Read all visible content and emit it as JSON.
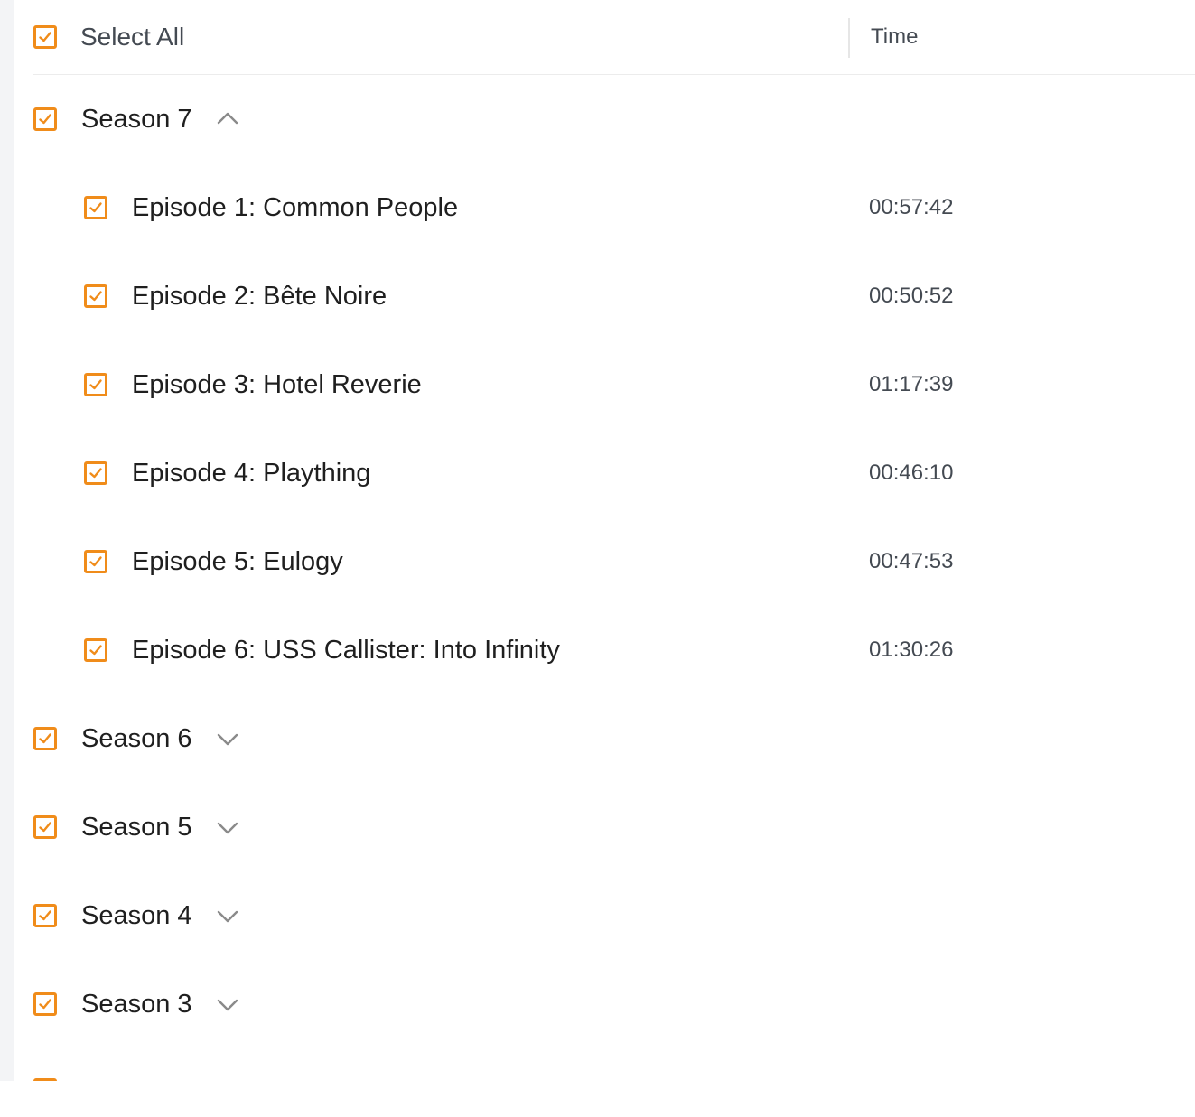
{
  "header": {
    "select_all_label": "Select All",
    "time_label": "Time"
  },
  "colors": {
    "accent": "#f08c1a",
    "text": "#1f1f1f",
    "muted_text": "#444a52",
    "chevron": "#8a8a8a"
  },
  "seasons": [
    {
      "label": "Season 7",
      "expanded": true,
      "checked": true,
      "episodes": [
        {
          "label": "Episode 1: Common People",
          "time": "00:57:42",
          "checked": true
        },
        {
          "label": "Episode 2: Bête Noire",
          "time": "00:50:52",
          "checked": true
        },
        {
          "label": "Episode 3: Hotel Reverie",
          "time": "01:17:39",
          "checked": true
        },
        {
          "label": "Episode 4: Plaything",
          "time": "00:46:10",
          "checked": true
        },
        {
          "label": "Episode 5: Eulogy",
          "time": "00:47:53",
          "checked": true
        },
        {
          "label": "Episode 6: USS Callister: Into Infinity",
          "time": "01:30:26",
          "checked": true
        }
      ]
    },
    {
      "label": "Season 6",
      "expanded": false,
      "checked": true
    },
    {
      "label": "Season 5",
      "expanded": false,
      "checked": true
    },
    {
      "label": "Season 4",
      "expanded": false,
      "checked": true
    },
    {
      "label": "Season 3",
      "expanded": false,
      "checked": true
    }
  ],
  "icons": {
    "checkbox": "checkbox-checked-icon",
    "expanded": "chevron-up-icon",
    "collapsed": "chevron-down-icon"
  }
}
